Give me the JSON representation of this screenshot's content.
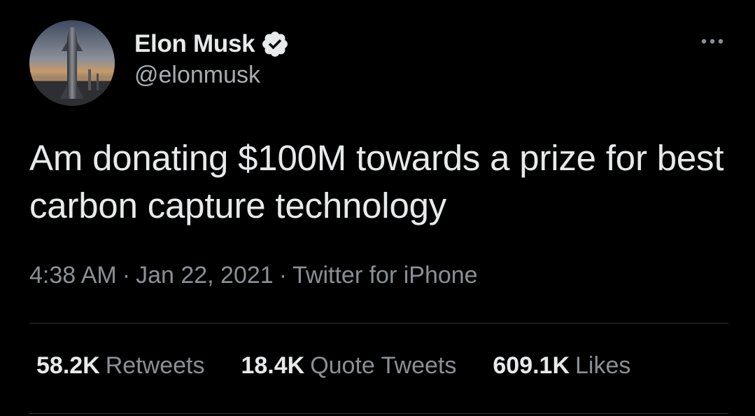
{
  "author": {
    "display_name": "Elon Musk",
    "handle": "@elonmusk",
    "verified_icon": "verified-badge-icon",
    "avatar_icon": "starship-avatar"
  },
  "tweet": {
    "text": "Am donating $100M towards a prize for best carbon capture technology"
  },
  "meta": {
    "time": "4:38 AM",
    "separator": "·",
    "date": "Jan 22, 2021",
    "source": "Twitter for iPhone"
  },
  "stats": {
    "retweets_count": "58.2K",
    "retweets_label": "Retweets",
    "quote_count": "18.4K",
    "quote_label": "Quote Tweets",
    "likes_count": "609.1K",
    "likes_label": "Likes"
  },
  "colors": {
    "background": "#000000",
    "primary_text": "#e7e9ea",
    "secondary_text": "#8b9096",
    "divider": "#2f3336"
  }
}
